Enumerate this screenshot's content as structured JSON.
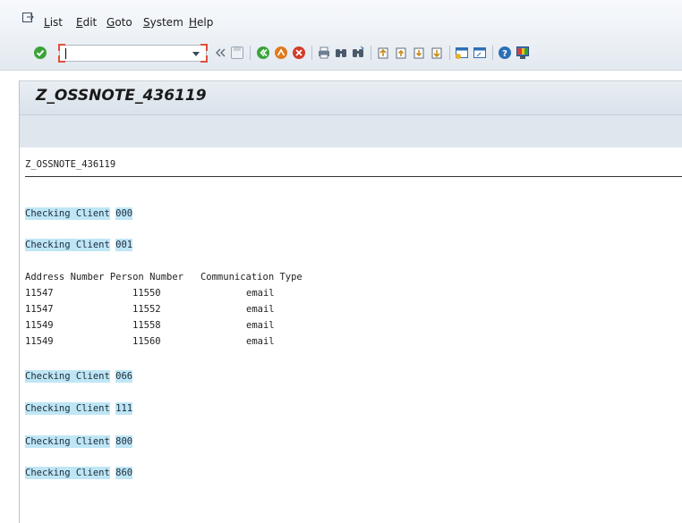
{
  "menu": {
    "items": [
      {
        "label": "List"
      },
      {
        "label": "Edit"
      },
      {
        "label": "Goto"
      },
      {
        "label": "System"
      },
      {
        "label": "Help"
      }
    ]
  },
  "toolbar": {
    "command_field_value": "",
    "icons": [
      "enter-icon",
      "command-field",
      "back-double-arrow-icon",
      "save-icon",
      "back-icon",
      "exit-icon",
      "cancel-icon",
      "print-icon",
      "find-icon",
      "find-next-icon",
      "first-page-icon",
      "previous-page-icon",
      "next-page-icon",
      "last-page-icon",
      "create-session-icon",
      "shortcut-icon",
      "help-icon",
      "customize-layout-icon"
    ]
  },
  "title": "Z_OSSNOTE_436119",
  "report": {
    "header": "Z_OSSNOTE_436119",
    "lines": [
      {
        "label": "Checking Client",
        "client": "000"
      },
      {
        "label": "Checking Client",
        "client": "001"
      }
    ],
    "table_header": "Address Number Person Number   Communication Type",
    "rows": [
      {
        "address": "11547",
        "person": "11550",
        "comm": "email"
      },
      {
        "address": "11547",
        "person": "11552",
        "comm": "email"
      },
      {
        "address": "11549",
        "person": "11558",
        "comm": "email"
      },
      {
        "address": "11549",
        "person": "11560",
        "comm": "email"
      }
    ],
    "after": [
      {
        "label": "Checking Client",
        "client": "066"
      },
      {
        "label": "Checking Client",
        "client": "111"
      },
      {
        "label": "Checking Client",
        "client": "800"
      },
      {
        "label": "Checking Client",
        "client": "860"
      }
    ]
  },
  "colors": {
    "highlight": "#bfe6f5",
    "enter_green": "#3aa33a",
    "exit_orange": "#e07a1f",
    "cancel_red": "#d23c2a"
  }
}
